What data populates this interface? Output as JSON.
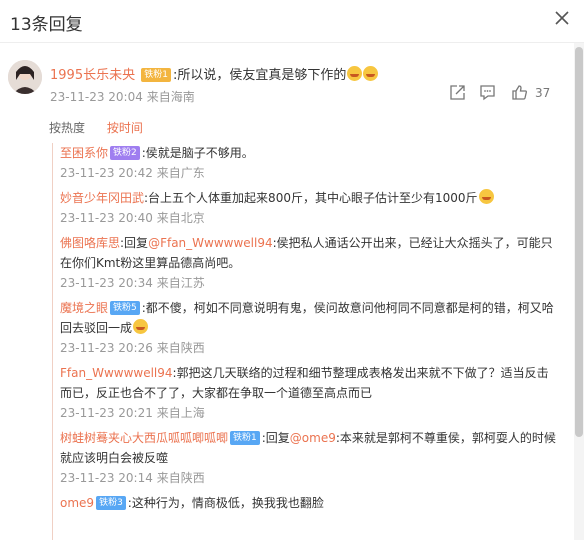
{
  "header": {
    "title": "13条回复"
  },
  "main_comment": {
    "username": "1995长乐未央",
    "badge": "铁粉1",
    "text": ":所以说，侯友宜真是够下作的",
    "time": "23-11-23 20:04",
    "location": "来自海南",
    "like_count": "37"
  },
  "sort": {
    "hot": "按热度",
    "time": "按时间"
  },
  "replies": [
    {
      "username": "至困系你",
      "badge": "铁粉2",
      "text": ":侯就是脑子不够用。",
      "time": "23-11-23 20:42",
      "location": "来自广东"
    },
    {
      "username": "妙音少年冈田武",
      "text": ":台上五个人体重加起来800斤，其中心眼子估计至少有1000斤",
      "time": "23-11-23 20:40",
      "location": "来自北京"
    },
    {
      "username": "佛图咯库思",
      "reply_prefix": ":回复",
      "mention": "@Ffan_Wwwwwell94",
      "text": ":侯把私人通话公开出来，已经让大众摇头了，可能只在你们Kmt粉这里算品德高尚吧。",
      "time": "23-11-23 20:34",
      "location": "来自江苏"
    },
    {
      "username": "魔境之眼",
      "badge": "铁粉5",
      "text": ":都不傻，柯如不同意说明有鬼，侯问故意问他柯同不同意都是柯的错，柯又哈回去驳回一成",
      "time": "23-11-23 20:26",
      "location": "来自陕西"
    },
    {
      "username": "Ffan_Wwwwwell94",
      "text": ":郭把这几天联络的过程和细节整理成表格发出来就不下做了？适当反击而已，反正也合不了了，大家都在争取一个道德至高点而已",
      "time": "23-11-23 20:21",
      "location": "来自上海"
    },
    {
      "username": "树蛙树蓦夹心大西瓜呱呱唧呱唧",
      "badge": "铁粉1",
      "reply_prefix": ":回复",
      "mention": "@ome9",
      "text": ":本来就是郭柯不尊重侯，郭柯耍人的时候就应该明白会被反噬",
      "time": "23-11-23 20:14",
      "location": "来自陕西"
    },
    {
      "username": "ome9",
      "badge": "铁粉3",
      "text": ":这种行为，情商极低，换我我也翻脸",
      "time": "",
      "location": ""
    }
  ]
}
